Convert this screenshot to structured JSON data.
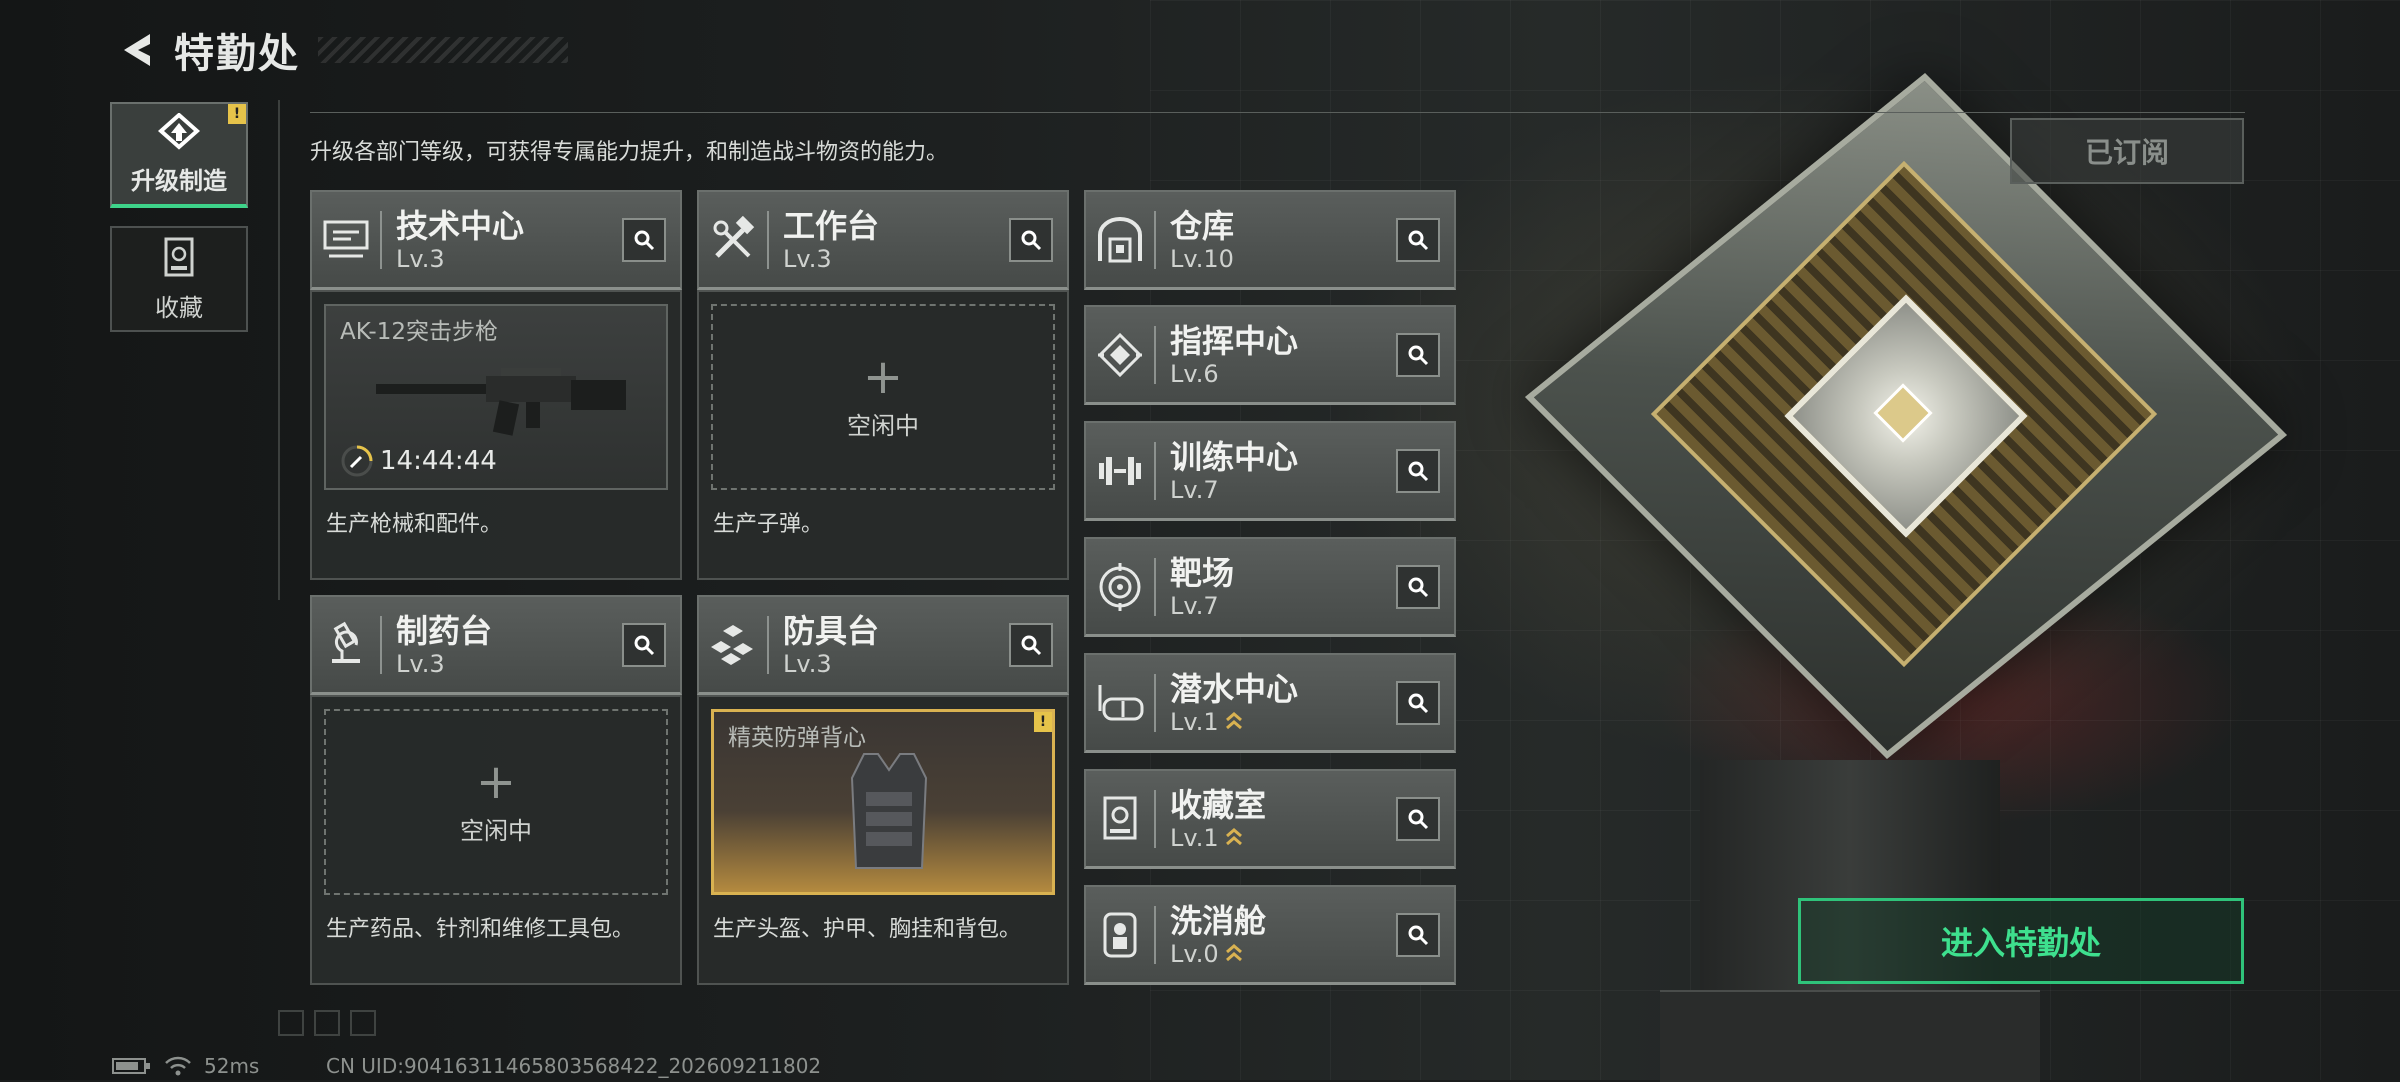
{
  "header": {
    "title": "特勤处"
  },
  "side_tabs": [
    {
      "label": "升级制造",
      "active": true,
      "badge": "!"
    },
    {
      "label": "收藏",
      "active": false
    }
  ],
  "description": "升级各部门等级，可获得专属能力提升，和制造战斗物资的能力。",
  "subscribed_label": "已订阅",
  "enter_button": "进入特勤处",
  "accent_color": "#3ed38a",
  "gold_color": "#d9b251",
  "production": [
    {
      "name": "技术中心",
      "level": "Lv.3",
      "icon": "tech-center-icon",
      "slot": {
        "state": "producing",
        "item": "AK-12突击步枪",
        "timer": "14:44:44"
      },
      "desc": "生产枪械和配件。"
    },
    {
      "name": "工作台",
      "level": "Lv.3",
      "icon": "workbench-icon",
      "slot": {
        "state": "idle",
        "label": "空闲中"
      },
      "desc": "生产子弹。"
    },
    {
      "name": "制药台",
      "level": "Lv.3",
      "icon": "pharmacy-icon",
      "slot": {
        "state": "idle",
        "label": "空闲中"
      },
      "desc": "生产药品、针剂和维修工具包。"
    },
    {
      "name": "防具台",
      "level": "Lv.3",
      "icon": "armor-bench-icon",
      "slot": {
        "state": "ready",
        "item": "精英防弹背心",
        "badge": "!"
      },
      "desc": "生产头盔、护甲、胸挂和背包。"
    }
  ],
  "departments": [
    {
      "name": "仓库",
      "level": "Lv.10",
      "icon": "warehouse-icon",
      "upgrade": false
    },
    {
      "name": "指挥中心",
      "level": "Lv.6",
      "icon": "command-center-icon",
      "upgrade": false
    },
    {
      "name": "训练中心",
      "level": "Lv.7",
      "icon": "training-center-icon",
      "upgrade": false
    },
    {
      "name": "靶场",
      "level": "Lv.7",
      "icon": "shooting-range-icon",
      "upgrade": false
    },
    {
      "name": "潜水中心",
      "level": "Lv.1",
      "icon": "diving-center-icon",
      "upgrade": true
    },
    {
      "name": "收藏室",
      "level": "Lv.1",
      "icon": "collection-room-icon",
      "upgrade": true
    },
    {
      "name": "洗消舱",
      "level": "Lv.0",
      "icon": "decon-chamber-icon",
      "upgrade": true
    }
  ],
  "status": {
    "ping": "52ms",
    "uid": "CN UID:9041631146580356842​2_202609211802"
  }
}
